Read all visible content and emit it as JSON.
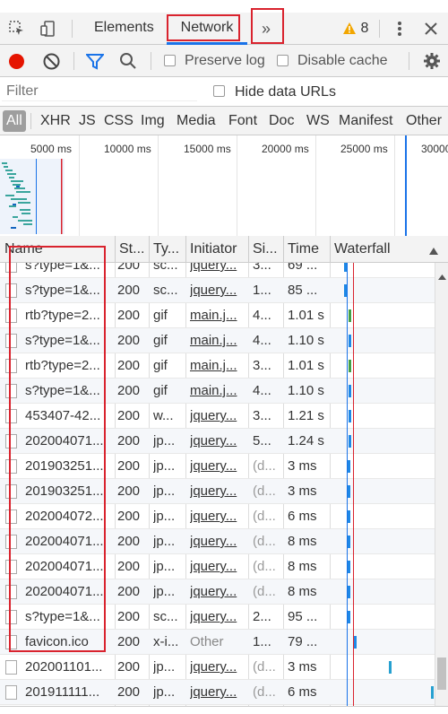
{
  "toolbar": {
    "inspect_icon": "cursor-arrow-icon",
    "device_icon": "mobile-device-icon",
    "tabs": [
      "Elements",
      "Network"
    ],
    "more_tabs": "»",
    "warning_count": "8",
    "warning_icon": "warning-triangle-icon",
    "menu_icon": "vertical-ellipsis-icon",
    "close_icon": "close-icon"
  },
  "network_toolbar": {
    "record_icon": "record-icon",
    "clear_icon": "clear-icon",
    "filter_icon": "funnel-icon",
    "search_icon": "search-icon",
    "preserve_log": "Preserve log",
    "disable_cache": "Disable cache",
    "settings_icon": "gear-icon"
  },
  "filter": {
    "placeholder": "Filter",
    "hide_data_urls": "Hide data URLs"
  },
  "type_filters": [
    "All",
    "XHR",
    "JS",
    "CSS",
    "Img",
    "Media",
    "Font",
    "Doc",
    "WS",
    "Manifest",
    "Other"
  ],
  "overview": {
    "ticks": [
      "5000 ms",
      "10000 ms",
      "15000 ms",
      "20000 ms",
      "25000 ms",
      "30000"
    ]
  },
  "columns": {
    "name": "Name",
    "status": "St...",
    "type": "Ty...",
    "initiator": "Initiator",
    "size": "Si...",
    "time": "Time",
    "waterfall": "Waterfall"
  },
  "rows": [
    {
      "name": "s?type=1&...",
      "status": "200",
      "type": "sc...",
      "initiator": "jquery...",
      "size": "3...",
      "time": "69 ...",
      "link": true,
      "grey": false
    },
    {
      "name": "s?type=1&...",
      "status": "200",
      "type": "sc...",
      "initiator": "jquery...",
      "size": "1...",
      "time": "85 ...",
      "link": true,
      "grey": false
    },
    {
      "name": "rtb?type=2...",
      "status": "200",
      "type": "gif",
      "initiator": "main.j...",
      "size": "4...",
      "time": "1.01 s",
      "link": true,
      "grey": false
    },
    {
      "name": "s?type=1&...",
      "status": "200",
      "type": "gif",
      "initiator": "main.j...",
      "size": "4...",
      "time": "1.10 s",
      "link": true,
      "grey": false
    },
    {
      "name": "rtb?type=2...",
      "status": "200",
      "type": "gif",
      "initiator": "main.j...",
      "size": "3...",
      "time": "1.01 s",
      "link": true,
      "grey": false
    },
    {
      "name": "s?type=1&...",
      "status": "200",
      "type": "gif",
      "initiator": "main.j...",
      "size": "4...",
      "time": "1.10 s",
      "link": true,
      "grey": false
    },
    {
      "name": "453407-42...",
      "status": "200",
      "type": "w...",
      "initiator": "jquery...",
      "size": "3...",
      "time": "1.21 s",
      "link": true,
      "grey": false
    },
    {
      "name": "202004071...",
      "status": "200",
      "type": "jp...",
      "initiator": "jquery...",
      "size": "5...",
      "time": "1.24 s",
      "link": true,
      "grey": false
    },
    {
      "name": "201903251...",
      "status": "200",
      "type": "jp...",
      "initiator": "jquery...",
      "size": "(d...",
      "time": "3 ms",
      "link": true,
      "grey": true
    },
    {
      "name": "201903251...",
      "status": "200",
      "type": "jp...",
      "initiator": "jquery...",
      "size": "(d...",
      "time": "3 ms",
      "link": true,
      "grey": true
    },
    {
      "name": "202004072...",
      "status": "200",
      "type": "jp...",
      "initiator": "jquery...",
      "size": "(d...",
      "time": "6 ms",
      "link": true,
      "grey": true
    },
    {
      "name": "202004071...",
      "status": "200",
      "type": "jp...",
      "initiator": "jquery...",
      "size": "(d...",
      "time": "8 ms",
      "link": true,
      "grey": true
    },
    {
      "name": "202004071...",
      "status": "200",
      "type": "jp...",
      "initiator": "jquery...",
      "size": "(d...",
      "time": "8 ms",
      "link": true,
      "grey": true
    },
    {
      "name": "202004071...",
      "status": "200",
      "type": "jp...",
      "initiator": "jquery...",
      "size": "(d...",
      "time": "8 ms",
      "link": true,
      "grey": true
    },
    {
      "name": "s?type=1&...",
      "status": "200",
      "type": "sc...",
      "initiator": "jquery...",
      "size": "2...",
      "time": "95 ...",
      "link": true,
      "grey": false
    },
    {
      "name": "favicon.ico",
      "status": "200",
      "type": "x-i...",
      "initiator": "Other",
      "size": "1...",
      "time": "79 ...",
      "link": false,
      "grey": false
    },
    {
      "name": "202001101...",
      "status": "200",
      "type": "jp...",
      "initiator": "jquery...",
      "size": "(d...",
      "time": "3 ms",
      "link": true,
      "grey": true
    },
    {
      "name": "201911111...",
      "status": "200",
      "type": "jp...",
      "initiator": "jquery...",
      "size": "(d...",
      "time": "6 ms",
      "link": true,
      "grey": true
    }
  ],
  "colors": {
    "accent": "#1a73e8",
    "annotation_red": "#d9232e",
    "record_red": "#e51400",
    "warning": "#f2a600"
  }
}
